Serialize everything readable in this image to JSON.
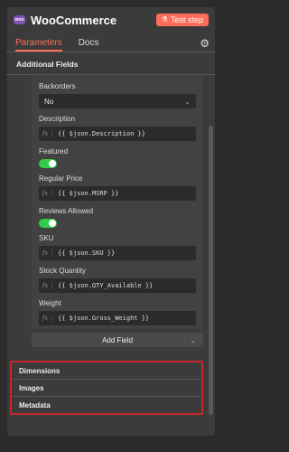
{
  "header": {
    "logo_text": "woo",
    "title": "WooCommerce",
    "test_step_label": "Test step"
  },
  "tabs": [
    {
      "label": "Parameters",
      "active": true
    },
    {
      "label": "Docs",
      "active": false
    }
  ],
  "section": {
    "title": "Additional Fields"
  },
  "fields": {
    "backorders": {
      "label": "Backorders",
      "value": "No"
    },
    "description": {
      "label": "Description",
      "value": "{{ $json.Description }}"
    },
    "featured": {
      "label": "Featured",
      "on": true
    },
    "regular_price": {
      "label": "Regular Price",
      "value": "{{ $json.MSRP }}"
    },
    "reviews_allowed": {
      "label": "Reviews Allowed",
      "on": true
    },
    "sku": {
      "label": "SKU",
      "value": "{{ $json.SKU }}"
    },
    "stock_quantity": {
      "label": "Stock Quantity",
      "value": "{{ $json.QTY_Available }}"
    },
    "weight": {
      "label": "Weight",
      "value": "{{ $json.Gross_Weight }}"
    }
  },
  "add_field_label": "Add Field",
  "collapsed_groups": [
    "Dimensions",
    "Images",
    "Metadata"
  ],
  "colors": {
    "accent": "#ff6d5a",
    "toggle_on": "#2fcc4a",
    "highlight_border": "#c62828"
  }
}
